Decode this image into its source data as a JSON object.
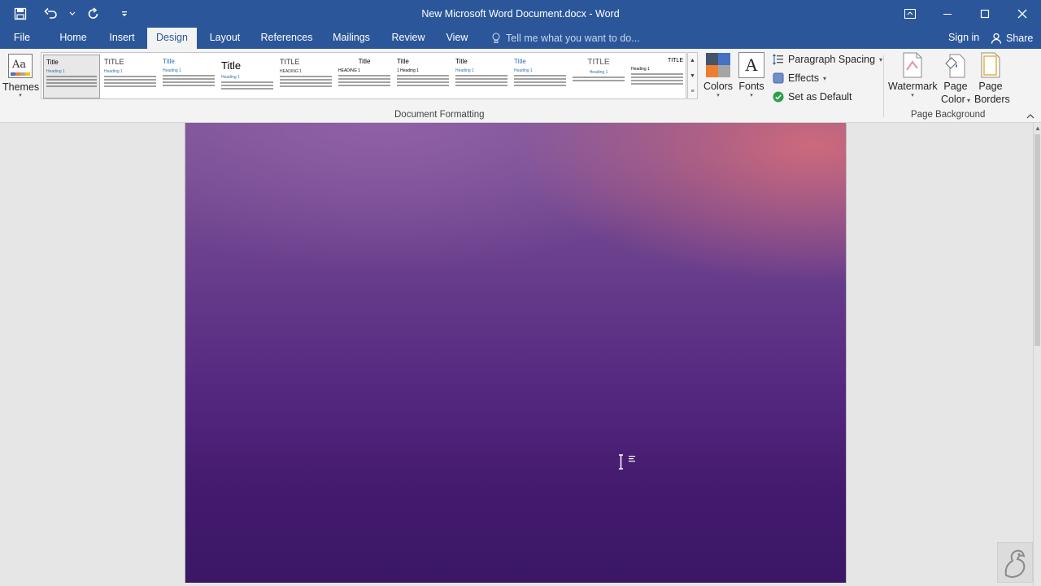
{
  "window": {
    "title": "New Microsoft Word Document.docx - Word"
  },
  "quick_access": {
    "icons": [
      "save-icon",
      "undo-icon",
      "dropdown-arrow-icon",
      "repeat-icon",
      "customize-icon"
    ]
  },
  "window_controls": {
    "icons": [
      "ribbon-display-icon",
      "minimize-icon",
      "restore-icon",
      "close-icon"
    ]
  },
  "tabs": [
    {
      "label": "File"
    },
    {
      "label": "Home"
    },
    {
      "label": "Insert"
    },
    {
      "label": "Design"
    },
    {
      "label": "Layout"
    },
    {
      "label": "References"
    },
    {
      "label": "Mailings"
    },
    {
      "label": "Review"
    },
    {
      "label": "View"
    }
  ],
  "active_tab": "Design",
  "tell_me": {
    "placeholder": "Tell me what you want to do..."
  },
  "account": {
    "signin": "Sign in",
    "share": "Share"
  },
  "ribbon": {
    "themes_label": "Themes",
    "style_gallery": [
      {
        "title": "Title",
        "heading": "Heading 1"
      },
      {
        "title": "TITLE",
        "heading": "Heading 1"
      },
      {
        "title": "Title",
        "heading": "Heading 1"
      },
      {
        "title": "Title",
        "heading": "Heading 1"
      },
      {
        "title": "TITLE",
        "heading": "HEADING 1"
      },
      {
        "title": "Title",
        "heading": "HEADING 1"
      },
      {
        "title": "Title",
        "heading": "1  Heading 1"
      },
      {
        "title": "Title",
        "heading": "Heading 1"
      },
      {
        "title": "Title",
        "heading": "Heading 1"
      },
      {
        "title": "TITLE",
        "heading": "Heading 1"
      },
      {
        "title": "TITLE",
        "heading": "Heading 1"
      }
    ],
    "document_formatting_label": "Document Formatting",
    "colors_label": "Colors",
    "fonts_label": "Fonts",
    "paragraph_spacing_label": "Paragraph Spacing",
    "effects_label": "Effects",
    "set_as_default_label": "Set as Default",
    "watermark_label": "Watermark",
    "page_color_label1": "Page",
    "page_color_label2": "Color",
    "page_borders_label1": "Page",
    "page_borders_label2": "Borders",
    "page_background_label": "Page Background"
  },
  "colors": {
    "title_bar": "#2b579a",
    "ribbon_bg": "#f3f3f3",
    "page_top": "#7a5294",
    "page_bottom": "#3b1766"
  }
}
